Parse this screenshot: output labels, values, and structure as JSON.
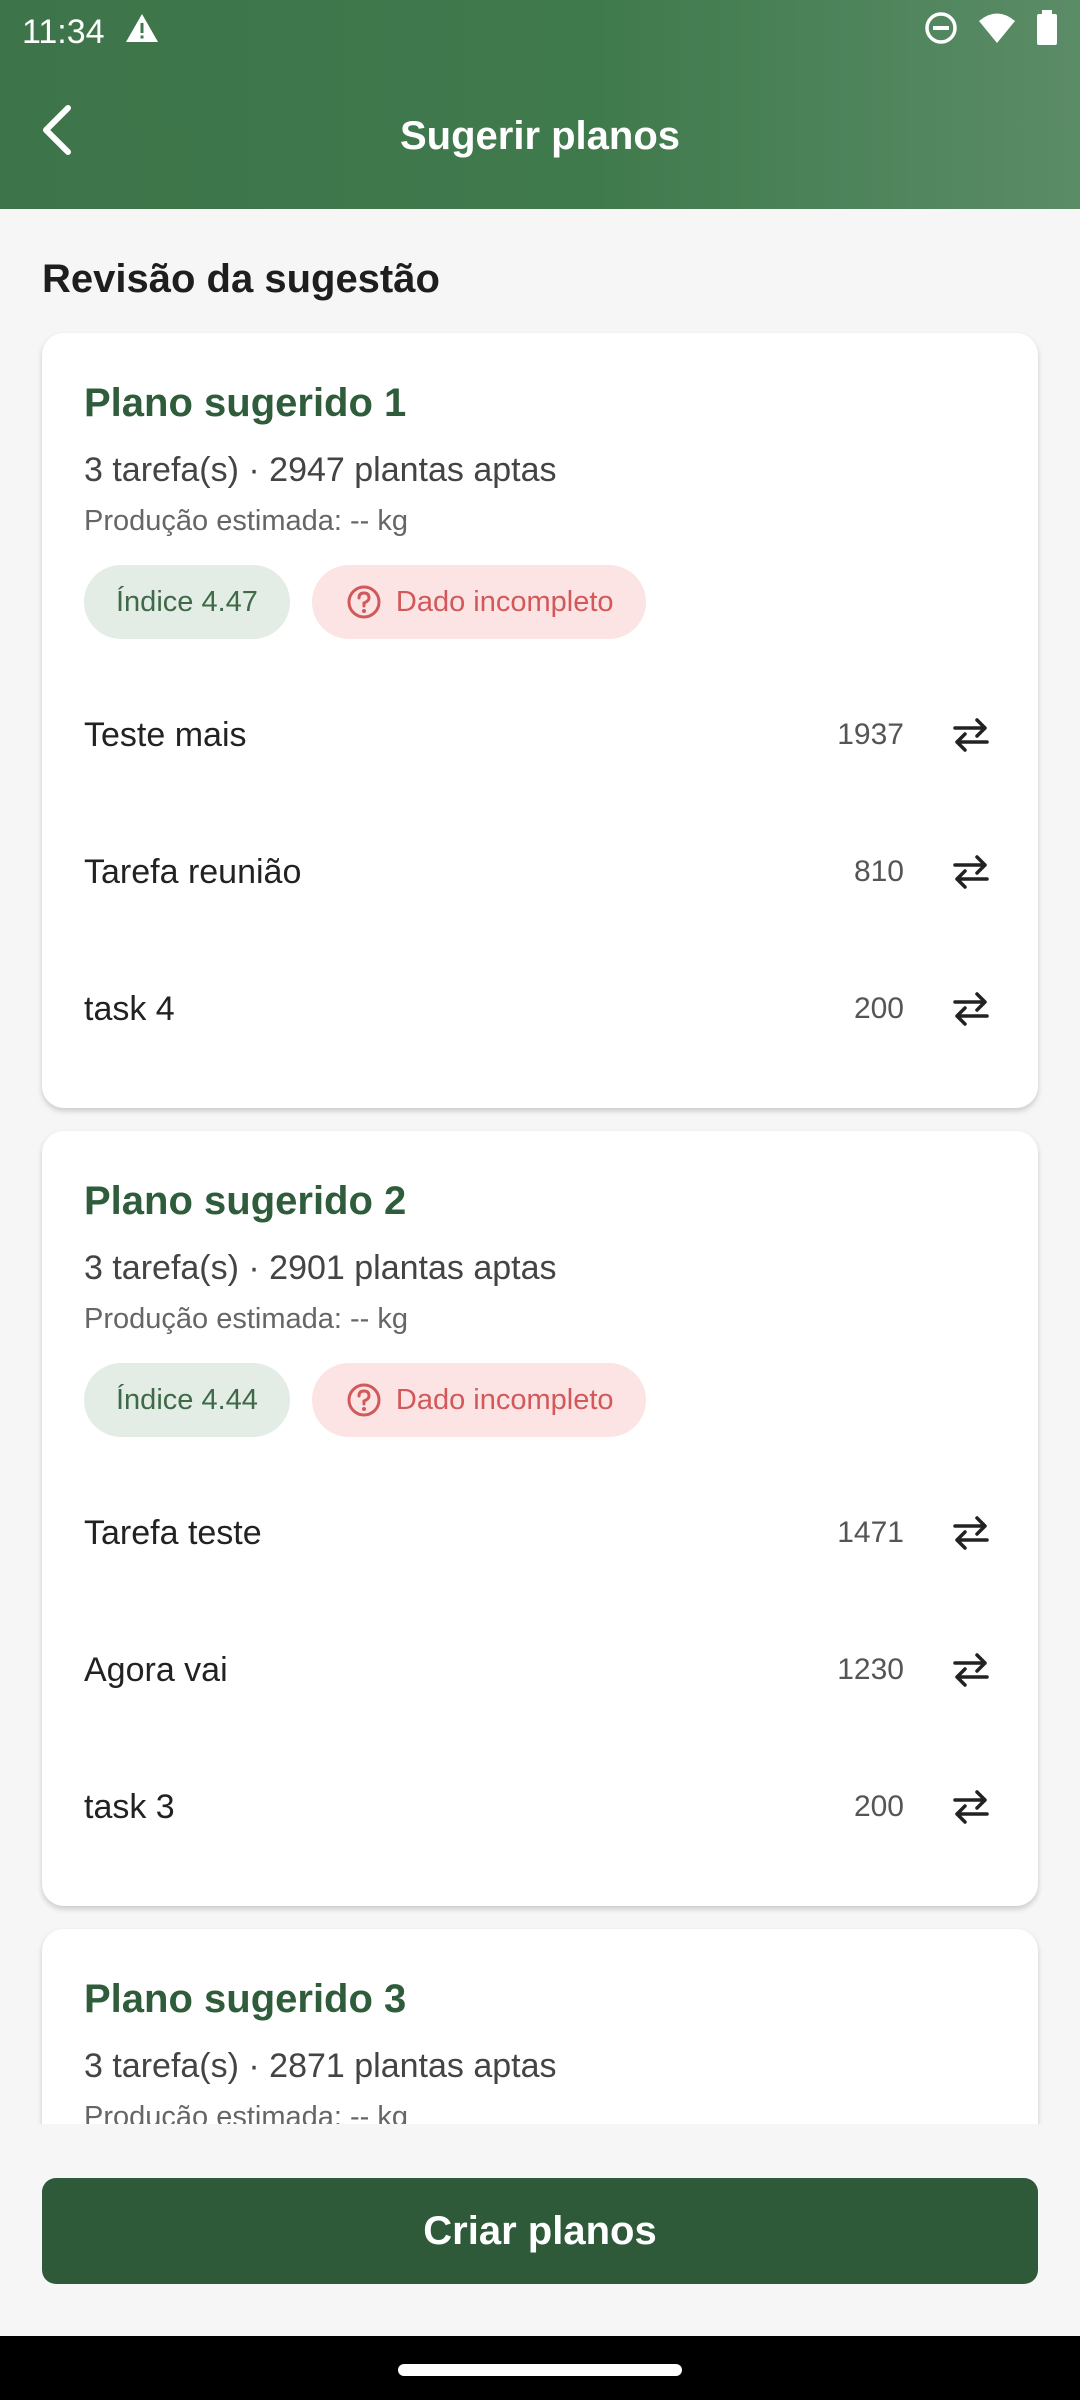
{
  "status_bar": {
    "time": "11:34",
    "icons": [
      "warning-icon",
      "do-not-disturb-icon",
      "wifi-icon",
      "battery-icon"
    ]
  },
  "app_bar": {
    "title": "Sugerir planos",
    "back_icon": "chevron-left-icon"
  },
  "section_title": "Revisão da sugestão",
  "plans": [
    {
      "title": "Plano sugerido 1",
      "summary": "3 tarefa(s) · 2947 plantas aptas",
      "production": "Produção estimada: -- kg",
      "index_chip": "Índice 4.47",
      "warning_chip": "Dado incompleto",
      "tasks": [
        {
          "name": "Teste mais",
          "count": "1937"
        },
        {
          "name": "Tarefa reunião",
          "count": "810"
        },
        {
          "name": "task 4",
          "count": "200"
        }
      ]
    },
    {
      "title": "Plano sugerido 2",
      "summary": "3 tarefa(s) · 2901 plantas aptas",
      "production": "Produção estimada: -- kg",
      "index_chip": "Índice 4.44",
      "warning_chip": "Dado incompleto",
      "tasks": [
        {
          "name": "Tarefa teste",
          "count": "1471"
        },
        {
          "name": "Agora vai",
          "count": "1230"
        },
        {
          "name": "task 3",
          "count": "200"
        }
      ]
    },
    {
      "title": "Plano sugerido 3",
      "summary": "3 tarefa(s) · 2871 plantas aptas",
      "production": "Produção estimada: -- kg"
    }
  ],
  "create_button": "Criar planos",
  "colors": {
    "header": "#3f7a4c",
    "primary_dark": "#2e5a39",
    "title_green": "#2f5c3a",
    "index_chip_bg": "#e3ece5",
    "warning_chip_bg": "#fbe4e3",
    "warning_text": "#d3585a"
  }
}
